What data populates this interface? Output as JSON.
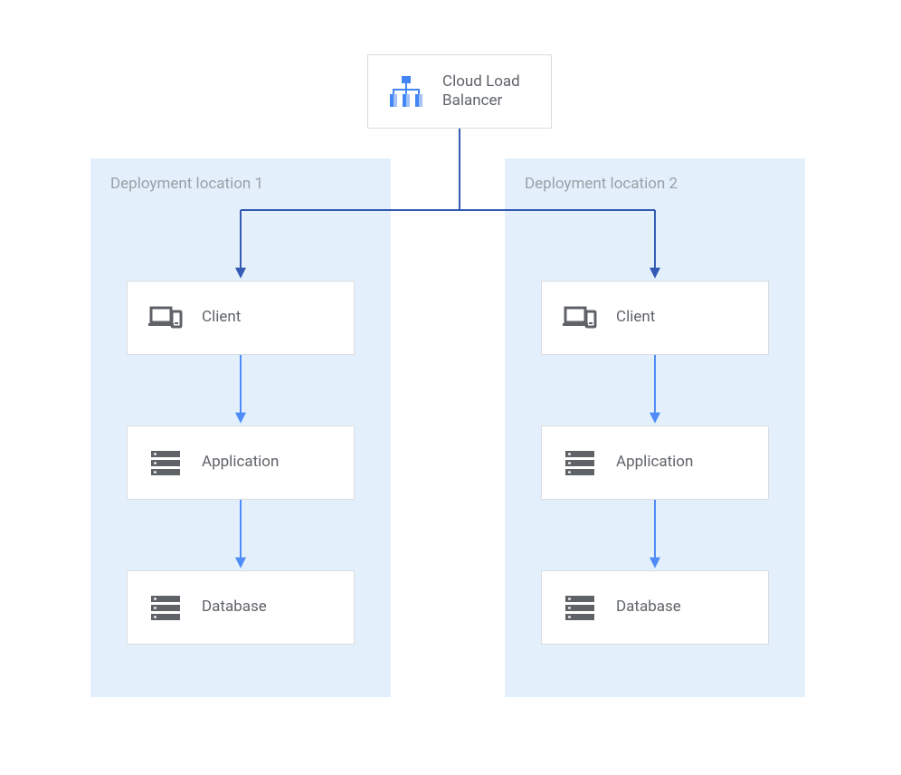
{
  "top": {
    "label": "Cloud Load\nBalancer"
  },
  "regions": {
    "left": {
      "title": "Deployment location 1"
    },
    "right": {
      "title": "Deployment location 2"
    }
  },
  "stacks": {
    "left": {
      "client": "Client",
      "app": "Application",
      "db": "Database"
    },
    "right": {
      "client": "Client",
      "app": "Application",
      "db": "Database"
    }
  },
  "colors": {
    "connector_dark": "#335bb3",
    "connector_light": "#4f8cf7",
    "region_bg": "#e3f0fb",
    "box_border": "#dadce0",
    "text": "#5f6368",
    "region_title": "#9aa0a6",
    "icon_gray": "#5f6368",
    "lb_icon_dark": "#4285f4",
    "lb_icon_light": "#a4c2f7"
  }
}
